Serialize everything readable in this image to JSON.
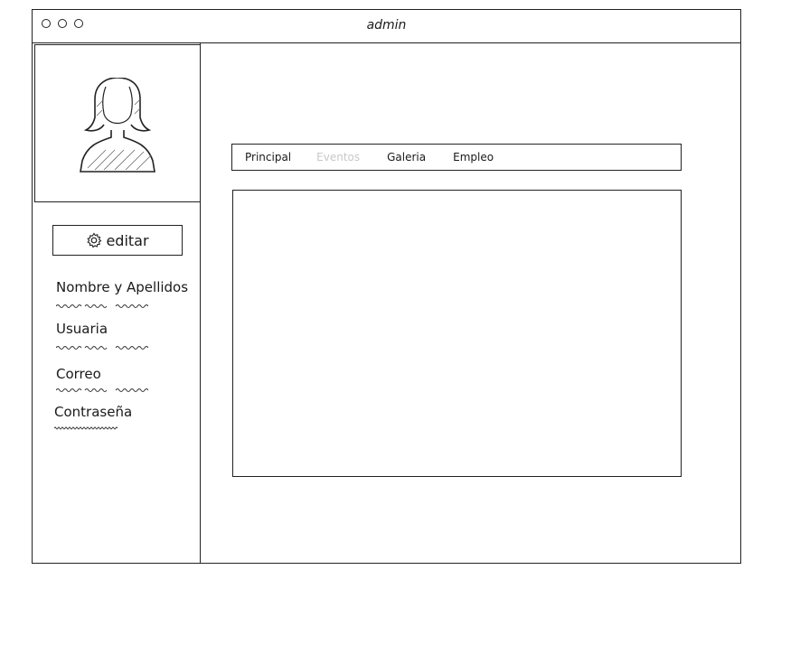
{
  "window": {
    "title": "admin"
  },
  "sidebar": {
    "edit_label": "editar",
    "fields": [
      {
        "label": "Nombre y Apellidos"
      },
      {
        "label": "Usuaria"
      },
      {
        "label": "Correo"
      },
      {
        "label": "Contraseña"
      }
    ]
  },
  "tabs": [
    {
      "label": "Principal",
      "active": false
    },
    {
      "label": "Eventos",
      "active": true
    },
    {
      "label": "Galeria",
      "active": false
    },
    {
      "label": "Empleo",
      "active": false
    }
  ],
  "icons": {
    "avatar": "user-female-icon",
    "edit": "gear-icon"
  }
}
